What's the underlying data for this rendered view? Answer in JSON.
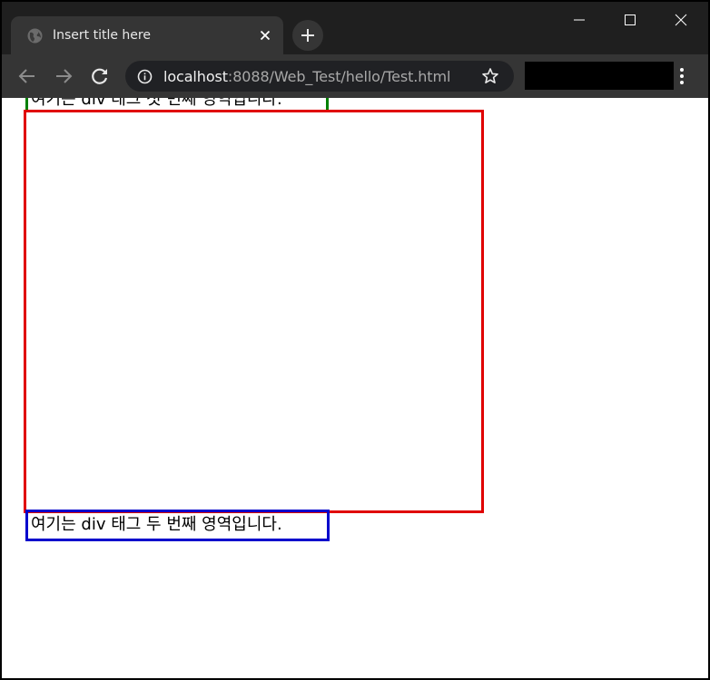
{
  "browser": {
    "tab_title": "Insert title here",
    "url_host": "localhost",
    "url_rest": ":8088/Web_Test/hello/Test.html"
  },
  "page": {
    "first_div_text": "여기는 div 태그 첫 번째 영역입니다.",
    "second_div_text": "여기는 div 태그 두 번째 영역입니다."
  },
  "colors": {
    "first_div_border": "#008000",
    "middle_div_border": "#e00000",
    "second_div_border": "#0000cc"
  }
}
